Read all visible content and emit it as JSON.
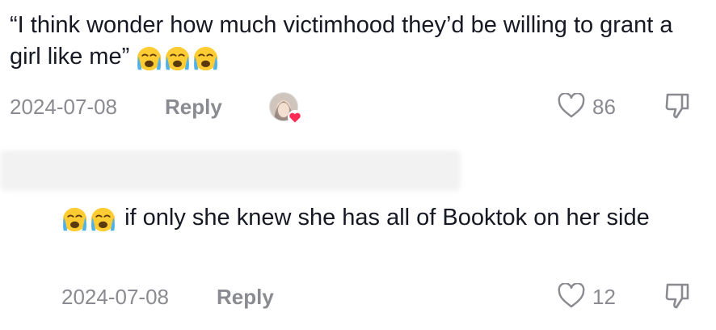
{
  "comment1": {
    "text": "“I think wonder how much victimhood they’d be willing to grant a girl like me”",
    "emojis": [
      "loudly-crying-face",
      "loudly-crying-face",
      "loudly-crying-face"
    ],
    "date": "2024-07-08",
    "reply_label": "Reply",
    "like_count": "86",
    "liked_by_creator": true
  },
  "comment2": {
    "emojis": [
      "loudly-crying-face",
      "loudly-crying-face"
    ],
    "text": "if only she knew she has all of Booktok on her side",
    "date": "2024-07-08",
    "reply_label": "Reply",
    "like_count": "12"
  },
  "colors": {
    "text": "#161823",
    "meta": "#8a8b91",
    "heart": "#fe2c55",
    "emoji_face": "#ffcc33",
    "emoji_tears": "#4fb3ea"
  }
}
